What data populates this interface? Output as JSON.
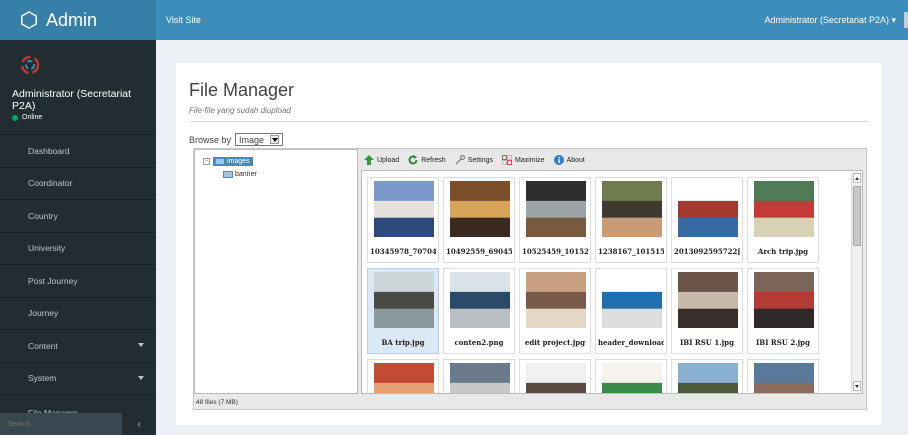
{
  "app": {
    "title": "Admin",
    "visit_site": "Visit Site",
    "account": "Administrator (Secretariat P2A) ▾"
  },
  "user": {
    "name": "Administrator (Secretariat P2A)",
    "status": "Online"
  },
  "sidebar": {
    "items": [
      {
        "label": "Dashboard",
        "has_caret": false
      },
      {
        "label": "Coordinator",
        "has_caret": false
      },
      {
        "label": "Country",
        "has_caret": false
      },
      {
        "label": "University",
        "has_caret": false
      },
      {
        "label": "Post Journey",
        "has_caret": false
      },
      {
        "label": "Journey",
        "has_caret": false
      },
      {
        "label": "Content",
        "has_caret": true
      },
      {
        "label": "System",
        "has_caret": true
      }
    ],
    "partial_item": "File Manager",
    "search_placeholder": "Search..."
  },
  "page": {
    "title": "File Manager",
    "subtitle": "File-file yang sudah diupload",
    "browse_label": "Browse by",
    "browse_value": "Image"
  },
  "file_manager": {
    "toolbar": [
      {
        "label": "Upload",
        "icon": "upload-icon"
      },
      {
        "label": "Refresh",
        "icon": "refresh-icon"
      },
      {
        "label": "Settings",
        "icon": "settings-icon"
      },
      {
        "label": "Maximize",
        "icon": "maximize-icon"
      },
      {
        "label": "About",
        "icon": "about-icon"
      }
    ],
    "tree": {
      "root": "images",
      "children": [
        "banner"
      ]
    },
    "status": "48 files (7 MB)",
    "files": [
      {
        "name": "10345978_70704!",
        "selected": false,
        "colors": [
          "#7a98c8",
          "#e6e1dc",
          "#2d4b7a"
        ]
      },
      {
        "name": "10492559_69045(",
        "selected": false,
        "colors": [
          "#7a4f2a",
          "#d7a45a",
          "#3b2a20"
        ]
      },
      {
        "name": "10525459_10152",
        "selected": false,
        "colors": [
          "#2e2e2e",
          "#9ca4a8",
          "#7a5a3e"
        ]
      },
      {
        "name": "1238167_101515(",
        "selected": false,
        "colors": [
          "#6f7a4e",
          "#3e3a30",
          "#c89a76"
        ]
      },
      {
        "name": "2013092595722[1",
        "selected": false,
        "colors": [
          "#ffffff",
          "#a43a2e",
          "#3a6aa3"
        ]
      },
      {
        "name": "Arch trip.jpg",
        "selected": false,
        "colors": [
          "#4f7a56",
          "#c43a38",
          "#d7d1b5"
        ]
      },
      {
        "name": "BA trip.jpg",
        "selected": true,
        "colors": [
          "#cfd6da",
          "#4a4b46",
          "#8a9a9c"
        ]
      },
      {
        "name": "conten2.png",
        "selected": false,
        "colors": [
          "#d9e2e6",
          "#2a4a6a",
          "#b8bec2"
        ]
      },
      {
        "name": "edit project.jpg",
        "selected": false,
        "colors": [
          "#c7a17f",
          "#7a5a48",
          "#e6d6c6"
        ]
      },
      {
        "name": "header_download",
        "selected": false,
        "colors": [
          "#ffffff",
          "#1f6fb0",
          "#dddddd"
        ]
      },
      {
        "name": "IBI RSU 1.jpg",
        "selected": false,
        "colors": [
          "#6a5448",
          "#c8b8a8",
          "#3a2e2a"
        ]
      },
      {
        "name": "IBI RSU 2.jpg",
        "selected": false,
        "colors": [
          "#7a6458",
          "#b43a34",
          "#2e2a2a"
        ]
      },
      {
        "name": "",
        "selected": false,
        "colors": [
          "#c44a32",
          "#e6a074",
          "#4a3a32"
        ]
      },
      {
        "name": "",
        "selected": false,
        "colors": [
          "#6a7a8a",
          "#c8c8c8",
          "#3a3a3a"
        ]
      },
      {
        "name": "",
        "selected": false,
        "colors": [
          "#f0f0f0",
          "#5a4a42",
          "#9a8a7a"
        ]
      },
      {
        "name": "",
        "selected": false,
        "colors": [
          "#f4f4ec",
          "#3a8a4a",
          "#d43a2a"
        ]
      },
      {
        "name": "",
        "selected": false,
        "colors": [
          "#8ab0d0",
          "#4a5a3a",
          "#e0e0e0"
        ]
      },
      {
        "name": "",
        "selected": false,
        "colors": [
          "#5a7a9a",
          "#8a6a5a",
          "#d0d8e0"
        ]
      }
    ]
  }
}
